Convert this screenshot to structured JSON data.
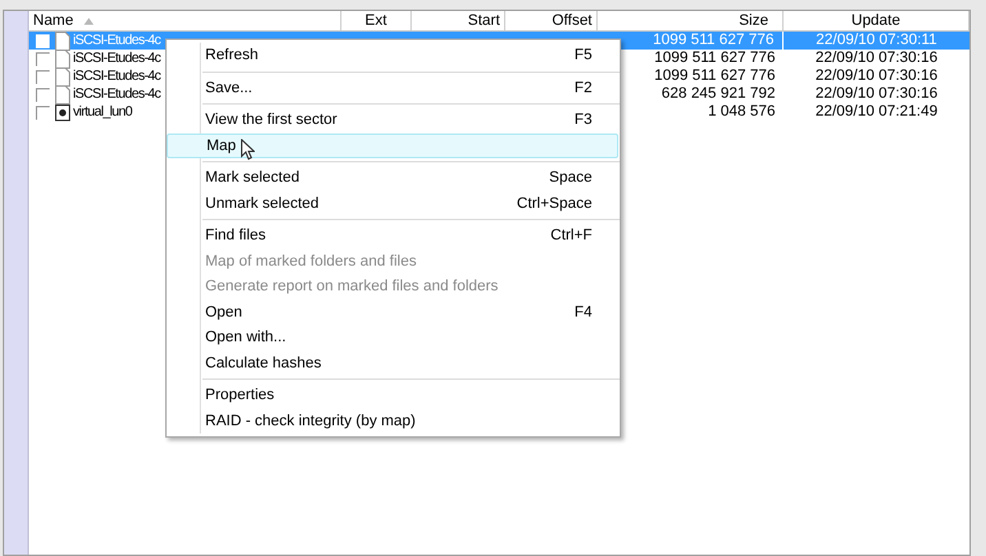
{
  "table": {
    "columns": [
      {
        "label": "Name",
        "sorted": true
      },
      {
        "label": "Ext",
        "sorted": false
      },
      {
        "label": "Start",
        "sorted": false
      },
      {
        "label": "Offset",
        "sorted": false
      },
      {
        "label": "Size",
        "sorted": false
      },
      {
        "label": "Update",
        "sorted": false
      }
    ],
    "rows": [
      {
        "kind": "file",
        "name": "iSCSI-Etudes-4c",
        "size": "1099 511 627 776",
        "update": "22/09/10 07:30:11",
        "checked": false,
        "selected": true
      },
      {
        "kind": "file",
        "name": "iSCSI-Etudes-4c",
        "size": "1099 511 627 776",
        "update": "22/09/10 07:30:16",
        "checked": false,
        "selected": false
      },
      {
        "kind": "file",
        "name": "iSCSI-Etudes-4c",
        "size": "1099 511 627 776",
        "update": "22/09/10 07:30:16",
        "checked": false,
        "selected": false
      },
      {
        "kind": "file",
        "name": "iSCSI-Etudes-4c",
        "size": "628 245 921 792",
        "update": "22/09/10 07:30:16",
        "checked": false,
        "selected": false
      },
      {
        "kind": "disk",
        "name": "virtual_lun0",
        "size": "1 048 576",
        "update": "22/09/10 07:21:49",
        "checked": false,
        "selected": false
      }
    ]
  },
  "context_menu": {
    "groups": [
      [
        {
          "label": "Refresh",
          "shortcut": "F5",
          "disabled": false,
          "selected": false
        }
      ],
      [
        {
          "label": "Save...",
          "shortcut": "F2",
          "disabled": false,
          "selected": false
        }
      ],
      [
        {
          "label": "View the first sector",
          "shortcut": "F3",
          "disabled": false,
          "selected": false
        },
        {
          "label": "Map",
          "disabled": false,
          "selected": true
        }
      ],
      [
        {
          "label": "Mark selected",
          "shortcut": "Space",
          "disabled": false,
          "selected": false
        },
        {
          "label": "Unmark selected",
          "shortcut": "Ctrl+Space",
          "disabled": false,
          "selected": false
        }
      ],
      [
        {
          "label": "Find files",
          "shortcut": "Ctrl+F",
          "disabled": false,
          "selected": false
        },
        {
          "label": "Map of marked folders and files",
          "disabled": true,
          "selected": false
        },
        {
          "label": "Generate report on marked files and folders",
          "disabled": true,
          "selected": false
        },
        {
          "label": "Open",
          "shortcut": "F4",
          "disabled": false,
          "selected": false
        },
        {
          "label": "Open with...",
          "disabled": false,
          "selected": false
        },
        {
          "label": "Calculate hashes",
          "disabled": false,
          "selected": false
        }
      ],
      [
        {
          "label": "Properties",
          "disabled": false,
          "selected": false
        },
        {
          "label": "RAID - check integrity (by map)",
          "disabled": false,
          "selected": false
        }
      ]
    ]
  }
}
